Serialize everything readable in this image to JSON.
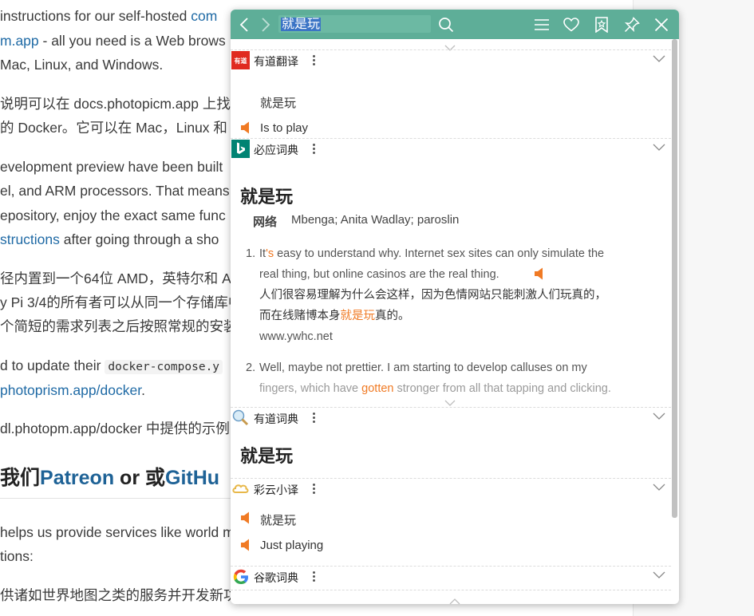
{
  "background": {
    "lines": [
      {
        "pre": "instructions for our self-hosted ",
        "link": "com",
        "post": ""
      },
      {
        "pre": "",
        "link": "m.app",
        "post": " - all you need is a Web brows"
      },
      {
        "pre": "Mac, Linux, and Windows.",
        "link": "",
        "post": ""
      },
      {
        "pre": "说明可以在 docs.photopicm.app 上找到",
        "link": "",
        "post": ""
      },
      {
        "pre": "的 Docker。它可以在 Mac，Linux 和",
        "link": "",
        "post": ""
      },
      {
        "pre": "evelopment preview have been built",
        "link": "",
        "post": ""
      },
      {
        "pre": "el, and ARM processors. That means",
        "link": "",
        "post": ""
      },
      {
        "pre": "epository, enjoy the exact same func",
        "link": "",
        "post": ""
      },
      {
        "pre": "",
        "link": "structions",
        "post": " after going through a sho"
      },
      {
        "pre": "径内置到一个64位 AMD，英特尔和 AR",
        "link": "",
        "post": ""
      },
      {
        "pre": "y Pi 3/4的所有者可以从同一个存储库中",
        "link": "",
        "post": ""
      },
      {
        "pre": "个简短的需求列表之后按照常规的安装",
        "link": "",
        "post": ""
      },
      {
        "pre": "d to update their ",
        "code": "docker-compose.y",
        "link": "",
        "post": ""
      },
      {
        "pre": "",
        "link": "photoprism.app/docker",
        "post": "."
      },
      {
        "pre": "dl.photopm.app/docker 中提供的示例",
        "link": "",
        "post": ""
      },
      {
        "pre": "helps us provide services like world m",
        "link": "",
        "post": ""
      },
      {
        "pre": "tions:",
        "link": "",
        "post": ""
      },
      {
        "pre": "供诸如世界地图之类的服务并开发新功",
        "link": "",
        "post": ""
      }
    ],
    "heading": {
      "pre": "我们",
      "link1": "Patreon",
      "mid": " or 或",
      "link2": "GitHu"
    }
  },
  "popup": {
    "search_value": "就是玩",
    "sections": {
      "youdao_fanyi": {
        "name": "有道翻译",
        "source": "就是玩",
        "translation": "Is to play"
      },
      "bing": {
        "name": "必应词典",
        "headword": "就是玩",
        "web_label": "网络",
        "web_value": "Mbenga; Anita Wadlay; paroslin",
        "examples": [
          {
            "num": "1.",
            "en1_pre": "It",
            "en1_hl": "'s",
            "en1_post": " easy to understand why. Internet sex sites can only simulate the",
            "en2": "real thing, but online casinos are the real thing.",
            "zh1": "人们很容易理解为什么会这样，因为色情网站只能刺激人们玩真的，",
            "zh2_pre": "而在线赌博本身",
            "zh2_hl": "就是玩",
            "zh2_post": "真的。",
            "source": "www.ywhc.net"
          },
          {
            "num": "2.",
            "en1": "Well, maybe not prettier. I am starting to develop calluses on my",
            "en2_pre": "fingers, which have ",
            "en2_hl": "gotten",
            "en2_post": " stronger from all that tapping and clicking."
          }
        ]
      },
      "youdao_dict": {
        "name": "有道词典",
        "headword": "就是玩"
      },
      "caiyun": {
        "name": "彩云小译",
        "source": "就是玩",
        "translation": "Just playing"
      },
      "google": {
        "name": "谷歌词典"
      }
    }
  },
  "icons": {
    "back": "chevron-left-icon",
    "forward": "chevron-right-icon",
    "search": "search-icon",
    "menu": "menu-icon",
    "favorite": "heart-icon",
    "history": "bookmark-icon",
    "pin": "pin-icon",
    "close": "close-icon"
  },
  "colors": {
    "topbar": "#5eae98",
    "accent_orange": "#f07a24",
    "link_blue": "#1f6aa5"
  }
}
